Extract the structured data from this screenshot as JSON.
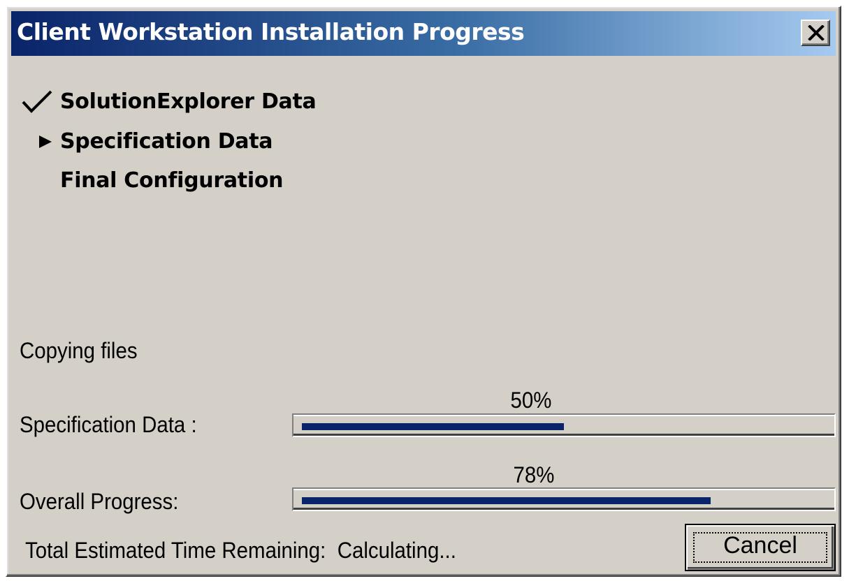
{
  "window": {
    "title": "Client Workstation Installation Progress",
    "close_glyph": "✕",
    "title_gradient": [
      "#0a246a",
      "#3a6ea5",
      "#a6caf0"
    ],
    "face_color": "#d4d0c8"
  },
  "steps": [
    {
      "label": "SolutionExplorer Data",
      "state": "completed",
      "icon": "checkmark-icon"
    },
    {
      "label": "Specification Data",
      "state": "current",
      "icon": "arrow-right-icon"
    },
    {
      "label": "Final Configuration",
      "state": "pending",
      "icon": ""
    }
  ],
  "status": {
    "message": "Copying files"
  },
  "progress": {
    "specification": {
      "label": "Specification Data :",
      "percent_text": "50%",
      "value": 0.5
    },
    "overall": {
      "label": "Overall Progress:",
      "percent_text": "78%",
      "value": 0.78
    },
    "bar_color": "#0a246a"
  },
  "footer": {
    "time_remaining": "Total Estimated Time Remaining:  Calculating...",
    "cancel_label": "Cancel"
  }
}
